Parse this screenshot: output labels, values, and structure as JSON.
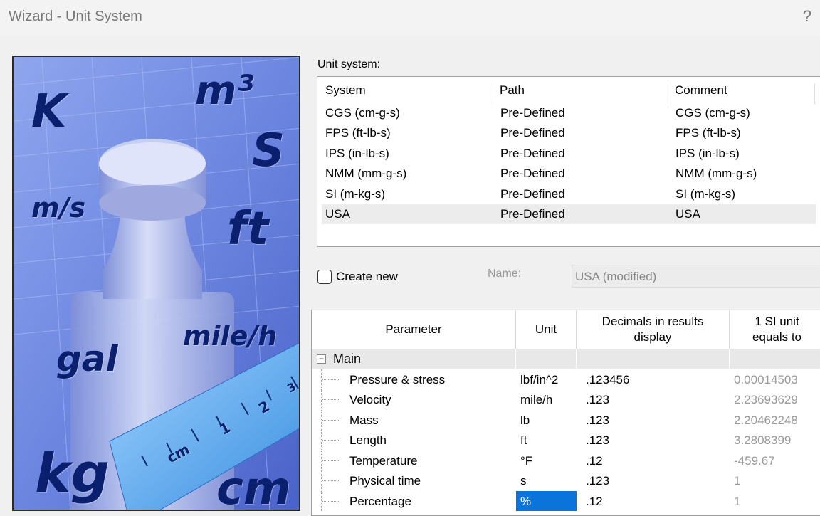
{
  "window": {
    "title": "Wizard - Unit System",
    "help": "?"
  },
  "wizard_image": {
    "glyphs": [
      "K",
      "m³",
      "S",
      "m/s",
      "ft",
      "mile/h",
      "gal",
      "kg",
      "cm"
    ],
    "ruler_labels": [
      "cm",
      "1",
      "2",
      "3"
    ]
  },
  "unit_system": {
    "label": "Unit system:",
    "columns": [
      "System",
      "Path",
      "Comment"
    ],
    "rows": [
      {
        "system": "CGS (cm-g-s)",
        "path": "Pre-Defined",
        "comment": "CGS (cm-g-s)"
      },
      {
        "system": "FPS (ft-lb-s)",
        "path": "Pre-Defined",
        "comment": "FPS (ft-lb-s)"
      },
      {
        "system": "IPS (in-lb-s)",
        "path": "Pre-Defined",
        "comment": "IPS (in-lb-s)"
      },
      {
        "system": "NMM (mm-g-s)",
        "path": "Pre-Defined",
        "comment": "NMM (mm-g-s)"
      },
      {
        "system": "SI (m-kg-s)",
        "path": "Pre-Defined",
        "comment": "SI (m-kg-s)"
      },
      {
        "system": "USA",
        "path": "Pre-Defined",
        "comment": "USA"
      }
    ],
    "selected": "USA"
  },
  "create_new": {
    "label": "Create new",
    "checked": false
  },
  "name": {
    "label": "Name:",
    "value": "USA (modified)"
  },
  "parameters": {
    "columns": {
      "parameter": "Parameter",
      "unit": "Unit",
      "decimals": "Decimals in results display",
      "si": "1 SI unit equals to"
    },
    "group": "Main",
    "group_expander": "−",
    "rows": [
      {
        "name": "Pressure & stress",
        "unit": "lbf/in^2",
        "decimals": ".123456",
        "si": "0.00014503"
      },
      {
        "name": "Velocity",
        "unit": "mile/h",
        "decimals": ".123",
        "si": "2.23693629"
      },
      {
        "name": "Mass",
        "unit": "lb",
        "decimals": ".123",
        "si": "2.20462248"
      },
      {
        "name": "Length",
        "unit": "ft",
        "decimals": ".123",
        "si": "3.2808399"
      },
      {
        "name": "Temperature",
        "unit": "°F",
        "decimals": ".12",
        "si": "-459.67"
      },
      {
        "name": "Physical time",
        "unit": "s",
        "decimals": ".123",
        "si": "1"
      },
      {
        "name": "Percentage",
        "unit": "%",
        "decimals": ".12",
        "si": "1"
      }
    ],
    "selected_unit_cell": "Percentage"
  },
  "colors": {
    "selection_blue": "#0a74da",
    "image_blue": "#5a78d8",
    "glyph_navy": "#0a1f6e"
  }
}
